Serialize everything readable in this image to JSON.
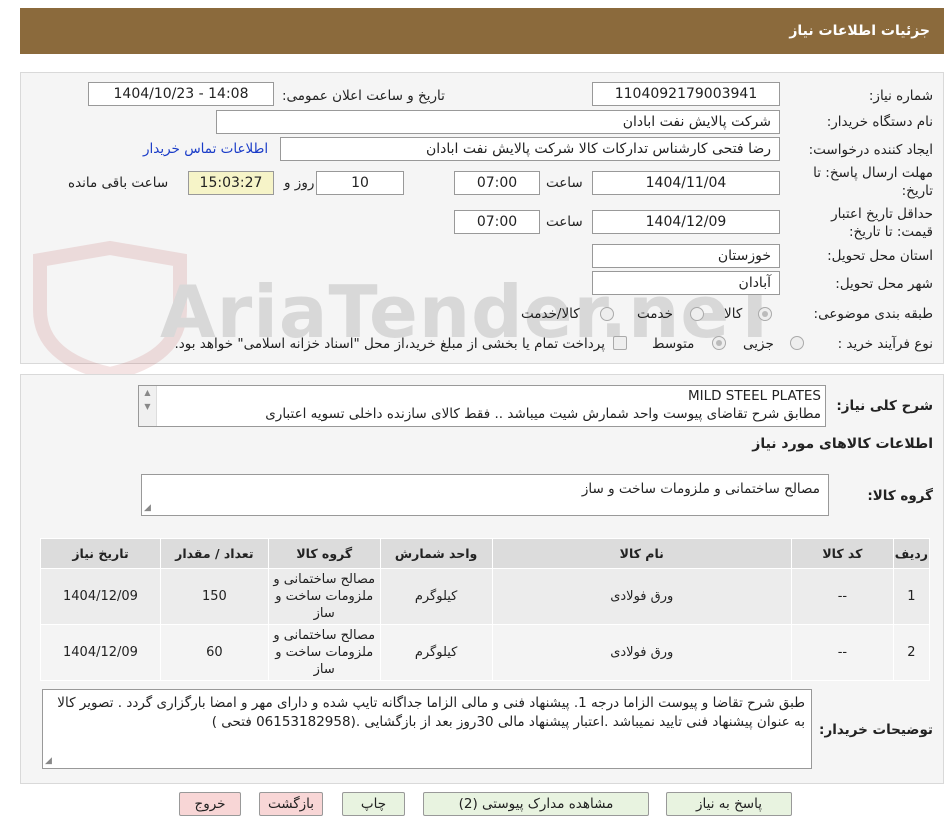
{
  "header": {
    "title": "جزئیات اطلاعات نیاز"
  },
  "form": {
    "need_number_label": "شماره نیاز:",
    "need_number": "1104092179003941",
    "announce_label": "تاریخ و ساعت اعلان عمومی:",
    "announce_value": "1404/10/23 - 14:08",
    "buyer_org_label": "نام دستگاه خریدار:",
    "buyer_org": "شرکت پالایش نفت ابادان",
    "creator_label": "ایجاد کننده درخواست:",
    "creator": "رضا فتحی کارشناس تدارکات کالا  شرکت پالایش نفت ابادان",
    "contact_link": "اطلاعات تماس خریدار",
    "deadline_label_1": "مهلت ارسال پاسخ: تا",
    "deadline_label_2": "تاریخ:",
    "deadline_date": "1404/11/04",
    "time_label": "ساعت",
    "deadline_time": "07:00",
    "days_value": "10",
    "days_label": "روز و",
    "remaining_time": "15:03:27",
    "remaining_label": "ساعت باقی مانده",
    "validity_label_1": "حداقل تاریخ اعتبار",
    "validity_label_2": "قیمت: تا تاریخ:",
    "validity_date": "1404/12/09",
    "validity_time": "07:00",
    "province_label": "استان محل تحویل:",
    "province": "خوزستان",
    "city_label": "شهر محل تحویل:",
    "city": "آبادان",
    "category_label": "طبقه بندی موضوعی:",
    "category_options": [
      "کالا",
      "خدمت",
      "کالا/خدمت"
    ],
    "process_label": "نوع فرآیند خرید :",
    "process_options": [
      "جزیی",
      "متوسط"
    ],
    "payment_note": "پرداخت تمام یا بخشی از مبلغ خرید،از محل \"اسناد خزانه اسلامی\" خواهد بود."
  },
  "watermark": {
    "text": "AriaTender.neT"
  },
  "description": {
    "label": "شرح کلی نیاز:",
    "line1": "MILD STEEL PLATES",
    "line2": "مطابق شرح تقاضای پیوست واحد شمارش شیت میباشد ..  فقط کالای سازنده داخلی  تسویه اعتباری"
  },
  "goods_info": {
    "title": "اطلاعات کالاهای مورد نیاز",
    "group_label": "گروه کالا:",
    "group_value": "مصالح ساختمانی و ملزومات ساخت و ساز"
  },
  "table": {
    "headers": [
      "ردیف",
      "کد کالا",
      "نام کالا",
      "واحد شمارش",
      "گروه کالا",
      "تعداد / مقدار",
      "تاریخ نیاز"
    ],
    "rows": [
      {
        "row": "1",
        "code": "--",
        "name": "ورق فولادی",
        "unit": "کیلوگرم",
        "group": "مصالح ساختمانی و ملزومات ساخت و ساز",
        "qty": "150",
        "date": "1404/12/09"
      },
      {
        "row": "2",
        "code": "--",
        "name": "ورق فولادی",
        "unit": "کیلوگرم",
        "group": "مصالح ساختمانی و ملزومات ساخت و ساز",
        "qty": "60",
        "date": "1404/12/09"
      }
    ]
  },
  "buyer_notes": {
    "label": "توضیحات خریدار:",
    "text": "طبق شرح تقاضا و پیوست الزاما درجه 1. پیشنهاد فنی و مالی الزاما جداگانه تایپ شده و دارای مهر و امضا بارگزاری گردد . تصویر کالا به عنوان پیشنهاد فنی تایید نمیباشد .اعتبار پیشنهاد مالی 30روز بعد از بازگشایی .(06153182958 فتحی )"
  },
  "buttons": {
    "reply": "پاسخ به نیاز",
    "attachments": "مشاهده مدارک پیوستی (2)",
    "print": "چاپ",
    "back": "بازگشت",
    "exit": "خروج"
  },
  "colors": {
    "header_bg": "#8b6a3c",
    "link": "#1a3cc8",
    "highlight": "#f6f4c8"
  }
}
